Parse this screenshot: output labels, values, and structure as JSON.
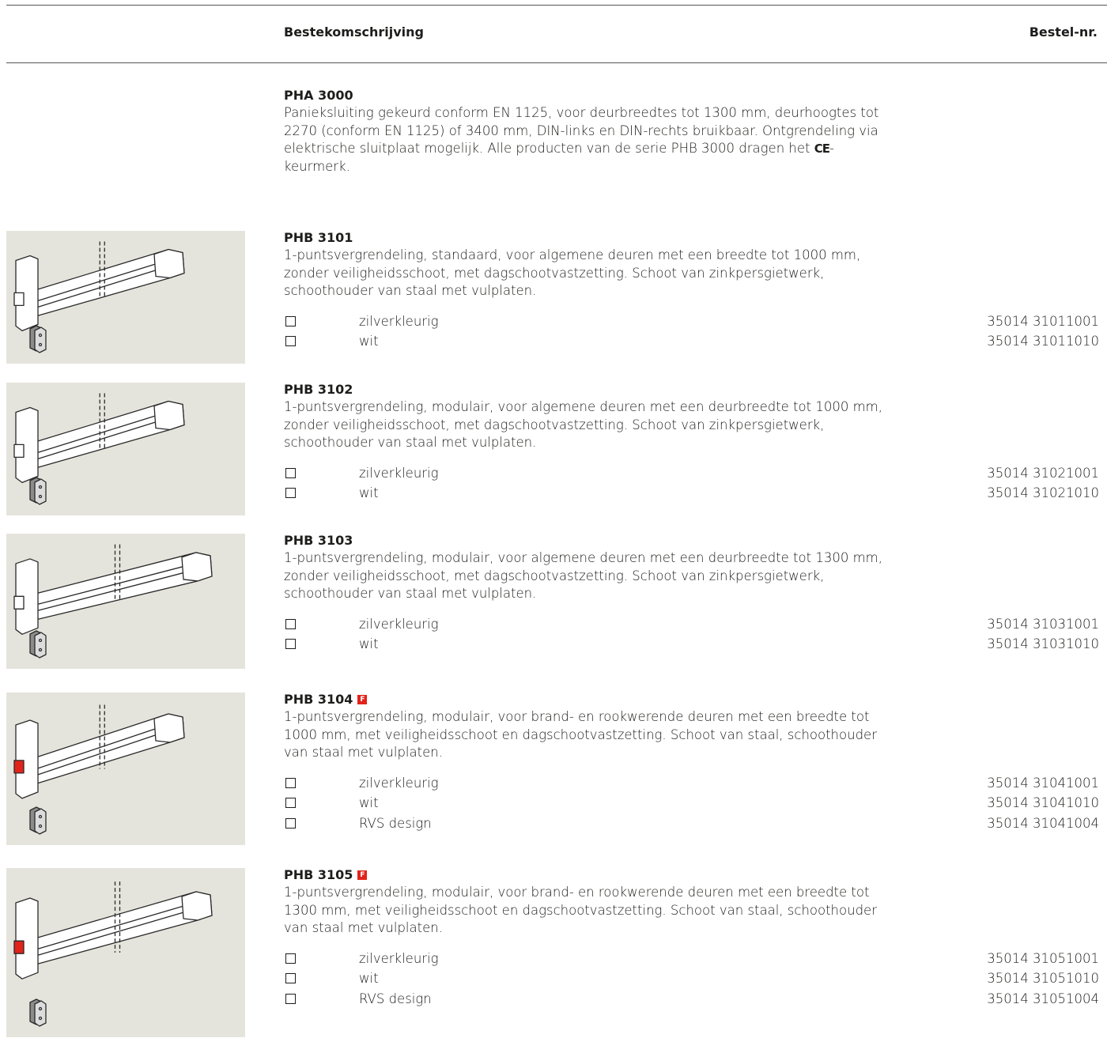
{
  "header": {
    "description_label": "Bestekomschrijving",
    "order_label": "Bestel-nr."
  },
  "intro": {
    "code": "PHA 3000",
    "description_before": "Panieksluiting gekeurd conform EN 1125, voor deurbreedtes tot 1300 mm, deurhoogtes tot 2270 (conform EN 1125) of 3400 mm, DIN-links en DIN-rechts bruikbaar. Ontgrendeling via elektrische sluitplaat mogelijk. Alle producten van de serie PHB 3000 dragen het",
    "ce_mark": "CE",
    "description_after": "-keurmerk."
  },
  "products": [
    {
      "code": "PHB 3101",
      "badge": "",
      "description": "1-puntsvergrendeling, standaard, voor algemene deuren met een breedte tot 1000 mm, zonder veiligheidsschoot, met dagschootvastzetting. Schoot van zinkpersgietwerk, schoothouder van staal met vulplaten.",
      "options": [
        {
          "label": "zilverkleurig",
          "number": "35014 31011001"
        },
        {
          "label": "wit",
          "number": "35014 31011010"
        }
      ]
    },
    {
      "code": "PHB 3102",
      "badge": "",
      "description": "1-puntsvergrendeling, modulair, voor algemene deuren met een deurbreedte tot 1000 mm, zonder veiligheidsschoot, met dagschootvastzetting. Schoot van zinkpersgietwerk, schoothouder van staal met vulplaten.",
      "options": [
        {
          "label": "zilverkleurig",
          "number": "35014 31021001"
        },
        {
          "label": "wit",
          "number": "35014 31021010"
        }
      ]
    },
    {
      "code": "PHB 3103",
      "badge": "",
      "description": "1-puntsvergrendeling, modulair, voor algemene deuren met een deurbreedte tot 1300 mm, zonder veiligheidsschoot, met dagschootvastzetting. Schoot van zinkpersgietwerk, schoothouder van staal met vulplaten.",
      "options": [
        {
          "label": "zilverkleurig",
          "number": "35014 31031001"
        },
        {
          "label": "wit",
          "number": "35014 31031010"
        }
      ]
    },
    {
      "code": "PHB 3104",
      "badge": "F",
      "description": "1-puntsvergrendeling, modulair, voor brand- en rookwerende deuren met een breedte tot 1000 mm, met veiligheidsschoot en dagschootvastzetting. Schoot van staal, schoothouder van staal met vulplaten.",
      "options": [
        {
          "label": "zilverkleurig",
          "number": "35014 31041001"
        },
        {
          "label": "wit",
          "number": "35014 31041010"
        },
        {
          "label": "RVS design",
          "number": "35014 31041004"
        }
      ]
    },
    {
      "code": "PHB 3105",
      "badge": "F",
      "description": "1-puntsvergrendeling, modulair, voor brand- en rookwerende deuren met een breedte tot 1300 mm, met veiligheidsschoot en dagschootvastzetting. Schoot van staal, schoothouder van staal met vulplaten.",
      "options": [
        {
          "label": "zilverkleurig",
          "number": "35014 31051001"
        },
        {
          "label": "wit",
          "number": "35014 31051010"
        },
        {
          "label": "RVS design",
          "number": "35014 31051004"
        }
      ]
    }
  ],
  "colors": {
    "thumb_bg": "#e5e4dc",
    "fire_badge": "#e2231a"
  }
}
